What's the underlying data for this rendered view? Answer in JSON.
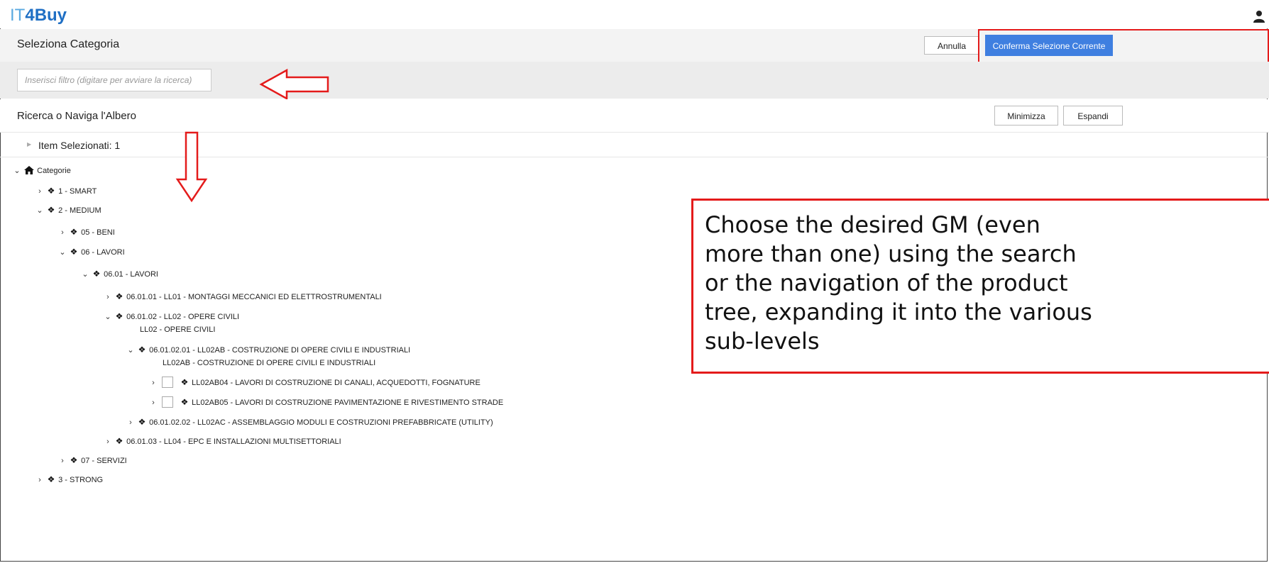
{
  "app": {
    "logo_it": "IT",
    "logo_4": "4",
    "logo_buy": "Buy"
  },
  "header": {
    "title": "Seleziona Categoria",
    "cancel_label": "Annulla",
    "confirm_label": "Conferma Selezione Corrente"
  },
  "filter": {
    "placeholder": "Inserisci filtro (digitare per avviare la ricerca)",
    "value": ""
  },
  "nav": {
    "title": "Ricerca o Naviga l'Albero",
    "minimize_label": "Minimizza",
    "expand_label": "Espandi"
  },
  "selected": {
    "label": "Item Selezionati: 1"
  },
  "tree": {
    "root": "Categorie",
    "n1": "1 - SMART",
    "n2": "2 - MEDIUM",
    "n2_1": "05 - BENI",
    "n2_2": "06 - LAVORI",
    "n2_2_1": "06.01 - LAVORI",
    "n2_2_1_1": "06.01.01 - LL01 - MONTAGGI MECCANICI ED ELETTROSTRUMENTALI",
    "n2_2_1_2": "06.01.02 - LL02 - OPERE CIVILI",
    "n2_2_1_2_desc": "LL02 - OPERE CIVILI",
    "n2_2_1_2_1": "06.01.02.01 - LL02AB - COSTRUZIONE DI OPERE CIVILI E INDUSTRIALI",
    "n2_2_1_2_1_desc": "LL02AB - COSTRUZIONE DI OPERE CIVILI E INDUSTRIALI",
    "leaf1": "LL02AB04 - LAVORI DI COSTRUZIONE DI CANALI, ACQUEDOTTI, FOGNATURE",
    "leaf2": "LL02AB05 - LAVORI DI COSTRUZIONE PAVIMENTAZIONE E RIVESTIMENTO STRADE",
    "n2_2_1_2_2": "06.01.02.02 - LL02AC - ASSEMBLAGGIO MODULI E COSTRUZIONI PREFABBRICATE (UTILITY)",
    "n2_2_1_3": "06.01.03 - LL04 - EPC E INSTALLAZIONI MULTISETTORIALI",
    "n2_3": "07 - SERVIZI",
    "n3": "3 - STRONG"
  },
  "callout": {
    "text": "Choose the desired GM (even more than one) using the search or the navigation of the product tree, expanding it into the various sub-levels"
  },
  "colors": {
    "accent": "#3f7fe0",
    "annotation": "#e41b1b",
    "logo_light": "#5aa9e0",
    "logo_dark": "#1f6fc4"
  },
  "icons": {
    "collapsed": "chevron-right-icon",
    "expanded": "chevron-down-icon",
    "category": "diamond-cluster-icon",
    "root": "home-icon",
    "user": "user-icon"
  }
}
